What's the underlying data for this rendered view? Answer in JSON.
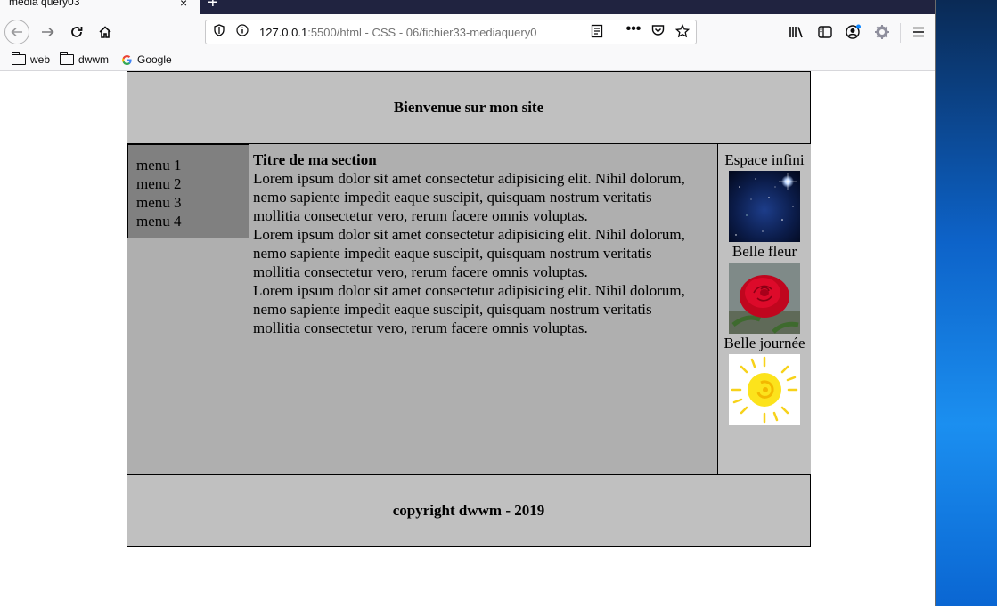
{
  "browser": {
    "tab_title": "media query03",
    "tab_close": "×",
    "new_tab": "+",
    "url_host": "127.0.0.1",
    "url_rest": ":5500/html - CSS - 06/fichier33-mediaquery0",
    "bookmarks": [
      {
        "label": "web",
        "icon": "folder-icon"
      },
      {
        "label": "dwwm",
        "icon": "folder-icon"
      },
      {
        "label": "Google",
        "icon": "google-icon"
      }
    ]
  },
  "page": {
    "header_title": "Bienvenue sur mon site",
    "menu": [
      "menu 1",
      "menu 2",
      "menu 3",
      "menu 4"
    ],
    "section_title": "Titre de ma section",
    "paragraphs": [
      "Lorem ipsum dolor sit amet consectetur adipisicing elit. Nihil dolorum, nemo sapiente impedit eaque suscipit, quisquam nostrum veritatis mollitia consectetur vero, rerum facere omnis voluptas.",
      "Lorem ipsum dolor sit amet consectetur adipisicing elit. Nihil dolorum, nemo sapiente impedit eaque suscipit, quisquam nostrum veritatis mollitia consectetur vero, rerum facere omnis voluptas.",
      "Lorem ipsum dolor sit amet consectetur adipisicing elit. Nihil dolorum, nemo sapiente impedit eaque suscipit, quisquam nostrum veritatis mollitia consectetur vero, rerum facere omnis voluptas."
    ],
    "aside": [
      {
        "caption": "Espace infini",
        "image": "space-image"
      },
      {
        "caption": "Belle fleur",
        "image": "rose-image"
      },
      {
        "caption": "Belle journée",
        "image": "sun-image"
      }
    ],
    "footer_text": "copyright dwwm - 2019"
  },
  "colors": {
    "header_bg": "#c0c0c0",
    "main_bg": "#afafaf",
    "menu_bg": "#808080",
    "tabbar_bg": "#202340"
  }
}
